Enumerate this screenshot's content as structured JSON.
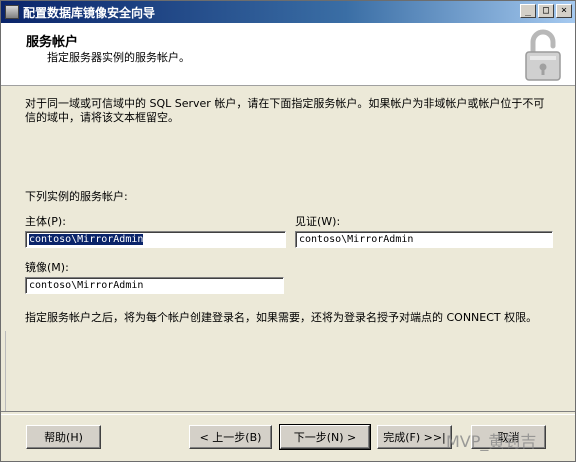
{
  "window": {
    "title": "配置数据库镜像安全向导",
    "controls": [
      "_",
      "□",
      "×"
    ]
  },
  "header": {
    "title": "服务帐户",
    "subtitle": "指定服务器实例的服务帐户。",
    "icon": "padlock-icon"
  },
  "main": {
    "intro": "对于同一域或可信域中的 SQL Server 帐户，请在下面指定服务帐户。如果帐户为非域帐户或帐户位于不可信的域中，请将该文本框留空。",
    "section_label": "下列实例的服务帐户:",
    "principal": {
      "label": "主体(P):",
      "value": "contoso\\MirrorAdmin"
    },
    "witness": {
      "label": "见证(W):",
      "value": "contoso\\MirrorAdmin"
    },
    "mirror": {
      "label": "镜像(M):",
      "value": "contoso\\MirrorAdmin"
    },
    "footnote": "指定服务帐户之后，将为每个帐户创建登录名，如果需要，还将为登录名授予对端点的 CONNECT 权限。"
  },
  "buttons": {
    "help": "帮助(H)",
    "back": "< 上一步(B)",
    "next": "下一步(N) >",
    "finish": "完成(F) >>|",
    "cancel": "取消"
  },
  "watermark": "MVP_黄钊吉",
  "colors": {
    "titlebar_start": "#0a246a",
    "dialog_bg": "#ece9d8",
    "selection": "#0a246a"
  }
}
